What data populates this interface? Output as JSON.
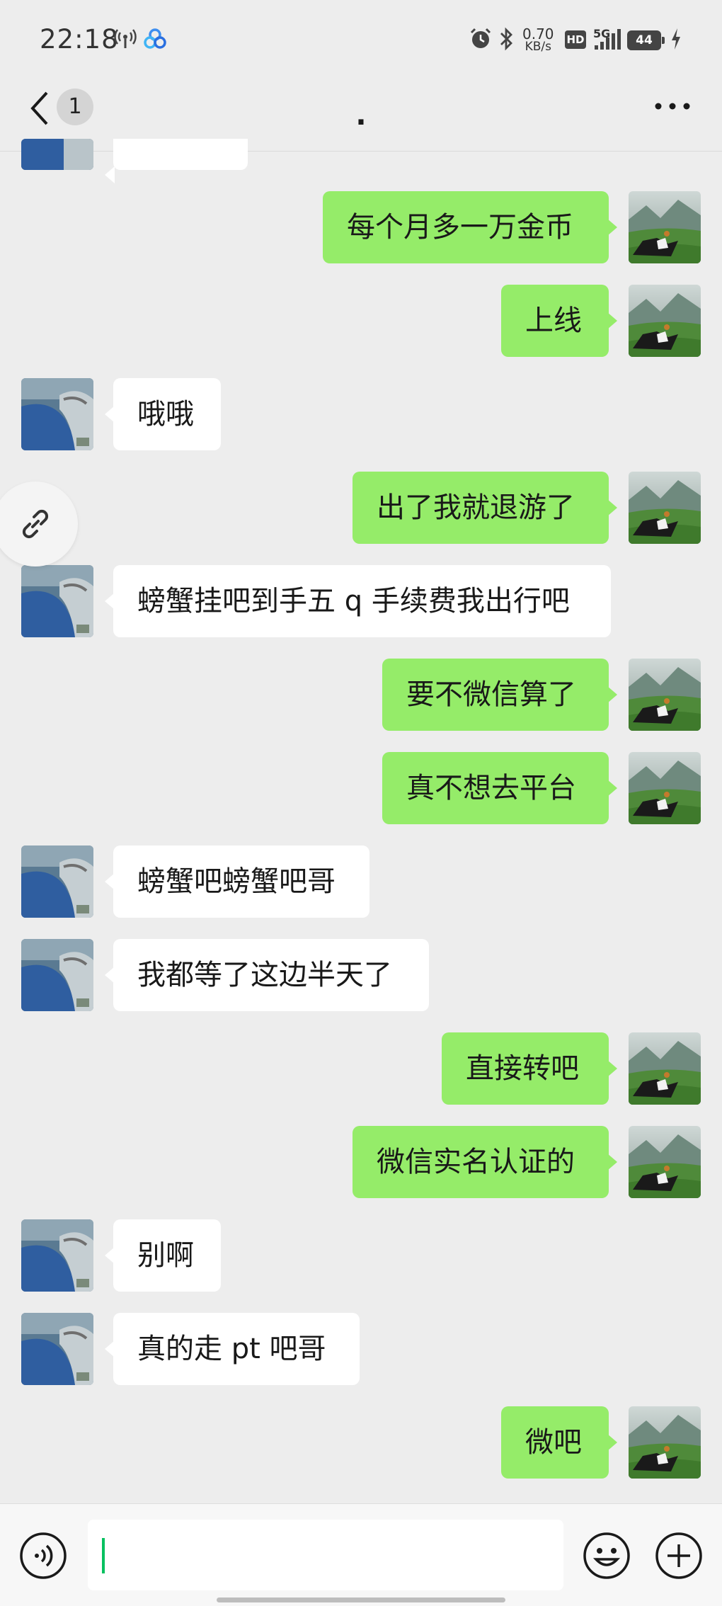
{
  "status_bar": {
    "time": "22:18",
    "speed_value": "0.70",
    "speed_unit": "KB/s",
    "hd_label": "HD",
    "network_label": "5G",
    "battery_level": "44"
  },
  "header": {
    "unread_count": "1",
    "title": "."
  },
  "messages": [
    {
      "sender": "me",
      "text": "每个月多一万金币"
    },
    {
      "sender": "me",
      "text": "上线"
    },
    {
      "sender": "them",
      "text": "哦哦"
    },
    {
      "sender": "me",
      "text": "出了我就退游了"
    },
    {
      "sender": "them",
      "text": "螃蟹挂吧到手五 q 手续费我出行吧"
    },
    {
      "sender": "me",
      "text": "要不微信算了"
    },
    {
      "sender": "me",
      "text": "真不想去平台"
    },
    {
      "sender": "them",
      "text": "螃蟹吧螃蟹吧哥"
    },
    {
      "sender": "them",
      "text": "我都等了这边半天了"
    },
    {
      "sender": "me",
      "text": "直接转吧"
    },
    {
      "sender": "me",
      "text": "微信实名认证的"
    },
    {
      "sender": "them",
      "text": "别啊"
    },
    {
      "sender": "them",
      "text": "真的走 pt 吧哥"
    },
    {
      "sender": "me",
      "text": "微吧"
    }
  ],
  "icons": {
    "back": "chevron-left-icon",
    "more": "more-dots-icon",
    "link": "link-icon",
    "voice": "voice-icon",
    "emoji": "emoji-icon",
    "plus": "plus-icon"
  },
  "colors": {
    "my_bubble": "#95ec69",
    "their_bubble": "#ffffff",
    "background": "#ededed",
    "caret": "#07c160"
  }
}
